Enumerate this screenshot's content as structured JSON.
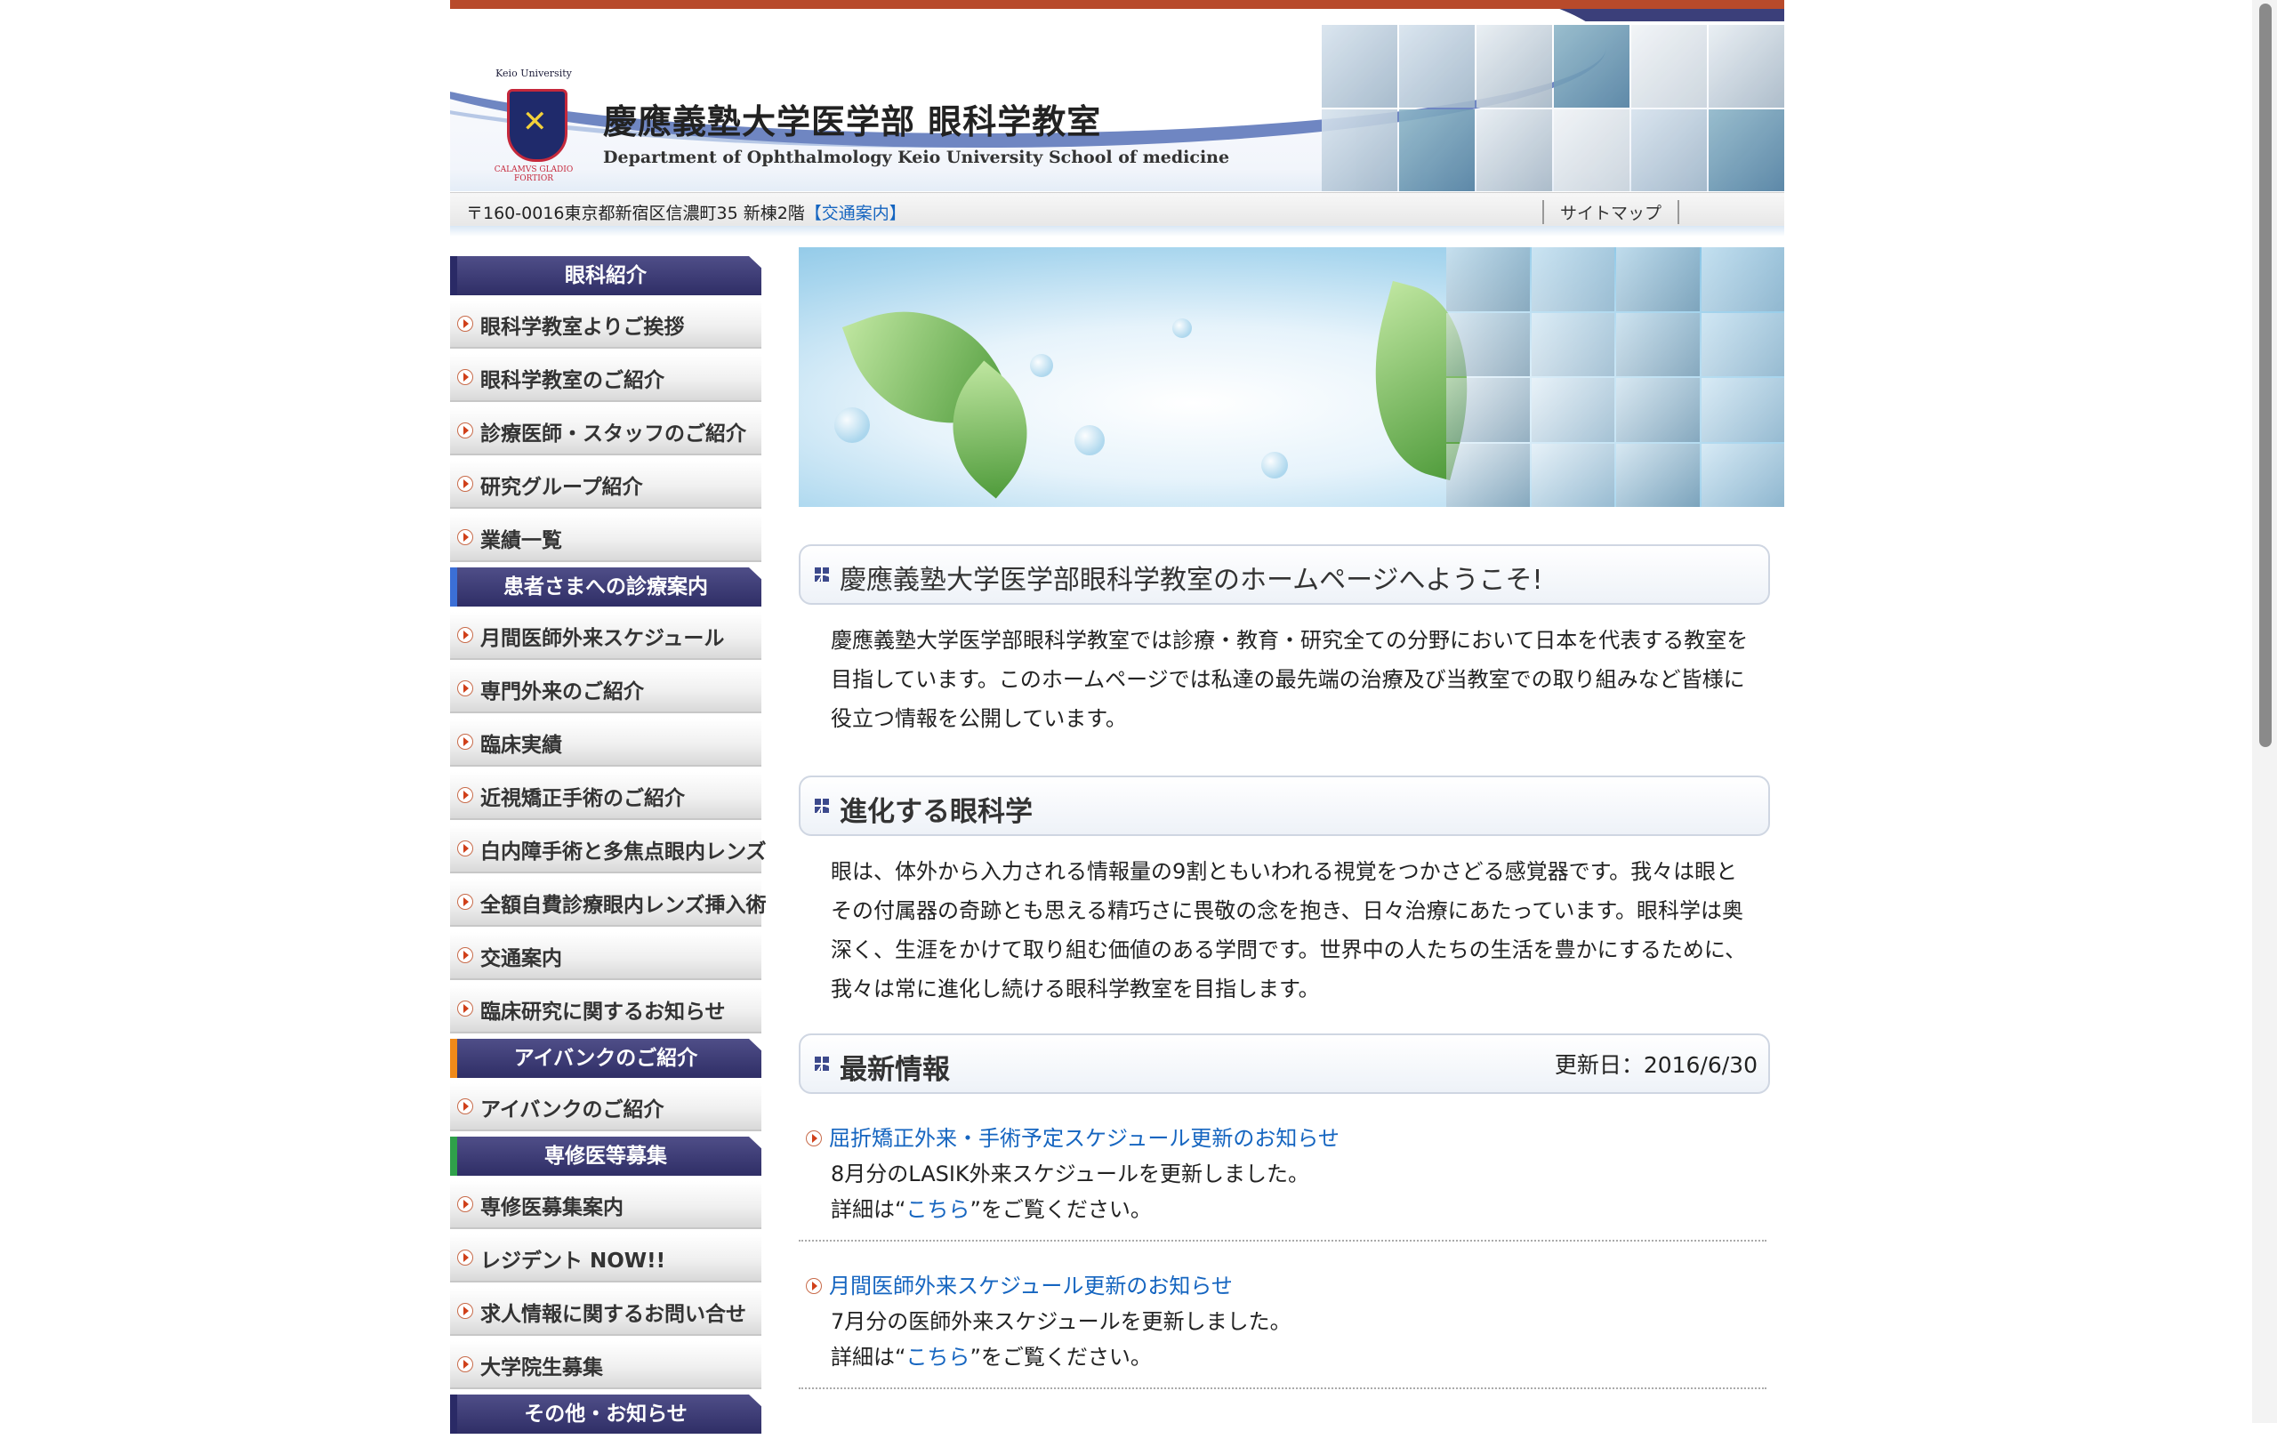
{
  "header": {
    "logo_university": "Keio University",
    "logo_motto": "CALAMVS GLADIO FORTIOR",
    "title": "慶應義塾大学医学部 眼科学教室",
    "subtitle": "Department of Ophthalmology Keio University School of  medicine",
    "address": "〒160-0016東京都新宿区信濃町35 新棟2階",
    "access_link": "【交通案内】",
    "sitemap": "サイトマップ"
  },
  "sidebar": {
    "sections": [
      {
        "title": "眼科紹介",
        "accent": "#2a2a66",
        "items": [
          "眼科学教室よりご挨拶",
          "眼科学教室のご紹介",
          "診療医師・スタッフのご紹介",
          "研究グループ紹介",
          "業績一覧"
        ]
      },
      {
        "title": "患者さまへの診療案内",
        "accent": "#3b6fd6",
        "items": [
          "月間医師外来スケジュール",
          "専門外来のご紹介",
          "臨床実績",
          "近視矯正手術のご紹介",
          "白内障手術と多焦点眼内レンズ",
          "全額自費診療眼内レンズ挿入術",
          "交通案内",
          "臨床研究に関するお知らせ"
        ]
      },
      {
        "title": "アイバンクのご紹介",
        "accent": "#f08a1a",
        "items": [
          "アイバンクのご紹介"
        ]
      },
      {
        "title": "専修医等募集",
        "accent": "#2fa04a",
        "items": [
          "専修医募集案内",
          "レジデント NOW!!",
          "求人情報に関するお問い合せ",
          "大学院生募集"
        ]
      },
      {
        "title": "その他・お知らせ",
        "accent": "#2a2a66",
        "items": []
      }
    ]
  },
  "main": {
    "welcome_title": "慶應義塾大学医学部眼科学教室のホームページへようこそ!",
    "welcome_text": "慶應義塾大学医学部眼科学教室では診療・教育・研究全ての分野において日本を代表する教室を目指しています。このホームページでは私達の最先端の治療及び当教室での取り組みなど皆様に役立つ情報を公開しています。",
    "evolve_title": "進化する眼科学",
    "evolve_text": "眼は、体外から入力される情報量の9割ともいわれる視覚をつかさどる感覚器です。我々は眼とその付属器の奇跡とも思える精巧さに畏敬の念を抱き、日々治療にあたっています。眼科学は奥深く、生涯をかけて取り組む価値のある学問です。世界中の人たちの生活を豊かにするために、我々は常に進化し続ける眼科学教室を目指します。",
    "news_title": "最新情報",
    "updated": "更新日：2016/6/30",
    "news": [
      {
        "link": "屈折矯正外来・手術予定スケジュール更新のお知らせ",
        "line1": "8月分のLASIK外来スケジュールを更新しました。",
        "detail_pre": "詳細は“",
        "detail_link": "こちら",
        "detail_post": "”をご覧ください。"
      },
      {
        "link": "月間医師外来スケジュール更新のお知らせ",
        "line1": "7月分の医師外来スケジュールを更新しました。",
        "detail_pre": "詳細は“",
        "detail_link": "こちら",
        "detail_post": "”をご覧ください。"
      }
    ]
  }
}
